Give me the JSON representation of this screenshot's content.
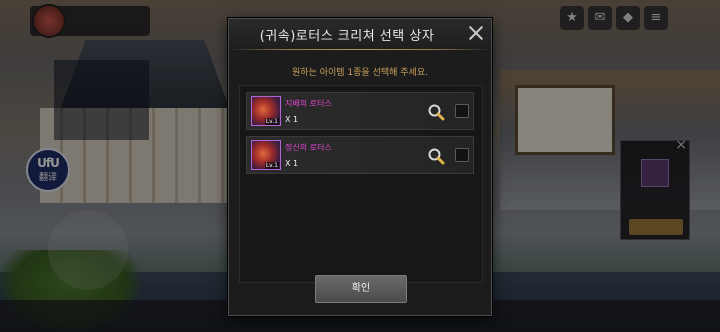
{
  "modal": {
    "title": "(귀속)로터스 크리쳐 선택 상자",
    "subtitle": "원하는 아이템 1종을 선택해 주세요.",
    "items": [
      {
        "name": "지배의 로터스",
        "quantity": "X 1",
        "level": "Lv.1",
        "icon": "lotus-creature-icon",
        "checked": false
      },
      {
        "name": "정신의 로터스",
        "quantity": "X 1",
        "level": "Lv.1",
        "icon": "lotus-creature-icon",
        "checked": false
      }
    ],
    "confirm_label": "확인"
  },
  "hud": {
    "translate_button": {
      "logo": "UfU",
      "label": "翻译"
    }
  },
  "colors": {
    "item_name": "#e246cf",
    "subtitle": "#c9a15a",
    "accent_line": "#b8985a"
  }
}
